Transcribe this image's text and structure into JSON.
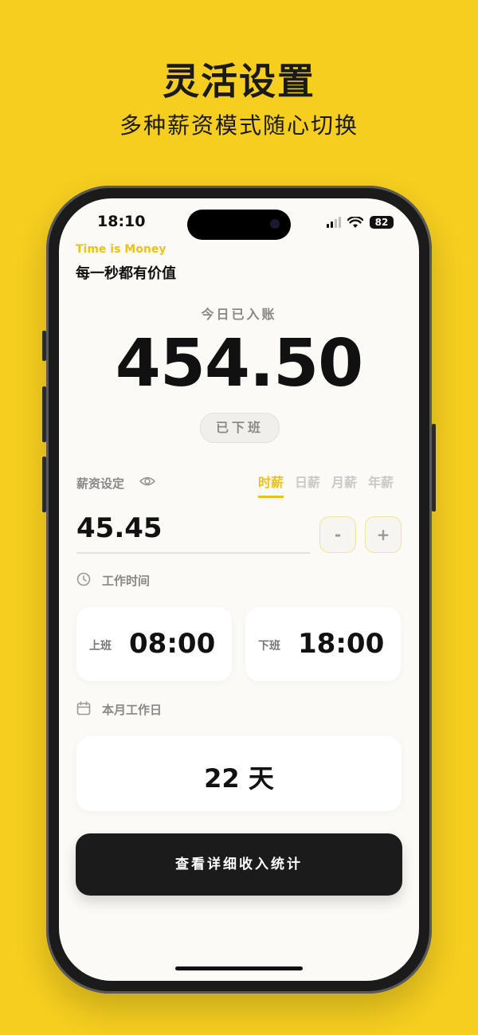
{
  "promo": {
    "title": "灵活设置",
    "subtitle": "多种薪资模式随心切换"
  },
  "status_bar": {
    "time": "18:10",
    "battery": "82"
  },
  "header": {
    "tagline_en": "Time is Money",
    "tagline_zh": "每一秒都有价值"
  },
  "earnings": {
    "label": "今日已入账",
    "amount": "454.50",
    "status": "已下班"
  },
  "salary": {
    "label": "薪资设定",
    "modes": [
      {
        "label": "时薪",
        "active": true
      },
      {
        "label": "日薪",
        "active": false
      },
      {
        "label": "月薪",
        "active": false
      },
      {
        "label": "年薪",
        "active": false
      }
    ],
    "value": "45.45",
    "decrement_label": "-",
    "increment_label": "+"
  },
  "work_time": {
    "label": "工作时间",
    "start": {
      "caption": "上班",
      "value": "08:00"
    },
    "end": {
      "caption": "下班",
      "value": "18:00"
    }
  },
  "work_days": {
    "label": "本月工作日",
    "value": "22 天"
  },
  "cta": {
    "label": "查看详细收入统计"
  },
  "colors": {
    "background": "#F5CE1F",
    "accent": "#EBC21D",
    "dark": "#1B1B1B"
  }
}
